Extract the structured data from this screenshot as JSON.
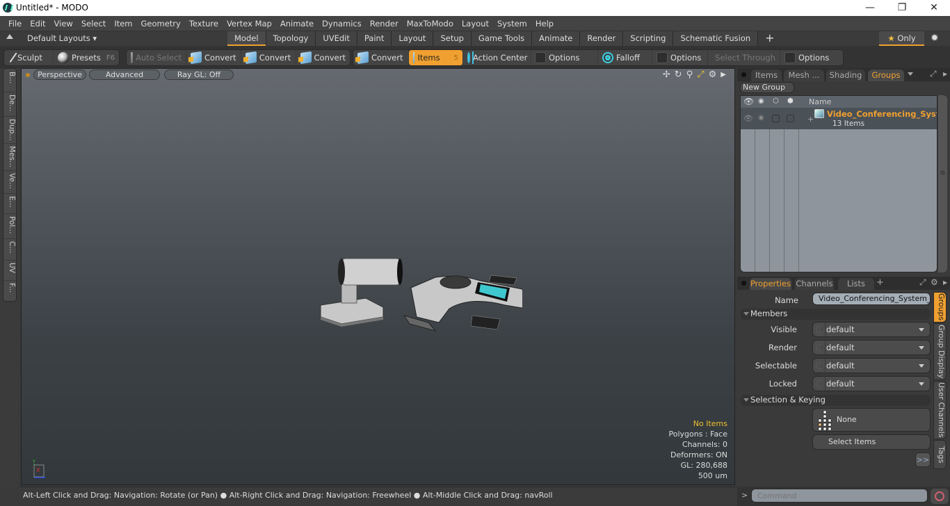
{
  "window": {
    "title": "Untitled* - MODO",
    "minimize": "—",
    "maximize": "❐",
    "close": "✕"
  },
  "menu": [
    "File",
    "Edit",
    "View",
    "Select",
    "Item",
    "Geometry",
    "Texture",
    "Vertex Map",
    "Animate",
    "Dynamics",
    "Render",
    "MaxToModo",
    "Layout",
    "System",
    "Help"
  ],
  "layoutbar": {
    "layouts_label": "Default Layouts ▾",
    "tabs": [
      "Model",
      "Topology",
      "UVEdit",
      "Paint",
      "Layout",
      "Setup",
      "Game Tools",
      "Animate",
      "Render",
      "Scripting",
      "Schematic Fusion"
    ],
    "active_tab": "Model",
    "add_tab": "+",
    "only_label": "Only",
    "star": "★",
    "gear": "✹"
  },
  "toolbar": {
    "sculpt": "Sculpt",
    "presets": "Presets",
    "presets_key": "F6",
    "auto_select": "Auto Select",
    "convert1": "Convert",
    "convert2": "Convert",
    "convert3": "Convert",
    "convert4": "Convert",
    "items": "Items",
    "items_count": "5",
    "action_center": "Action Center",
    "options1": "Options",
    "falloff": "Falloff",
    "options2": "Options",
    "select_through": "Select Through",
    "options3": "Options"
  },
  "left_tabs": [
    "B...",
    "De...",
    "Dup...",
    "Mes...",
    "Ve...",
    "E...",
    "Pol...",
    "C...",
    "UV",
    "F..."
  ],
  "viewport": {
    "view_mode": "Perspective",
    "shading": "Advanced",
    "raygl": "Ray GL: Off",
    "stats": {
      "selection": "No Items",
      "polygons": "Polygons : Face",
      "channels": "Channels: 0",
      "deformers": "Deformers: ON",
      "gl": "GL: 280,688",
      "unit": "500 um"
    },
    "axis": {
      "y": "Y",
      "x": "X"
    }
  },
  "statusbar": "Alt-Left Click and Drag: Navigation: Rotate (or Pan) ● Alt-Right Click and Drag: Navigation: Freewheel ● Alt-Middle Click and Drag: navRoll",
  "groups_panel": {
    "tabs": [
      "Items",
      "Mesh ...",
      "Shading",
      "Groups"
    ],
    "active_tab": "Groups",
    "new_group": "New Group",
    "col_name": "Name",
    "group": {
      "name": "Video_Conferencing_Syst...",
      "count": "13 Items",
      "expand": "+"
    }
  },
  "properties_panel": {
    "tabs": [
      "Properties",
      "Channels",
      "Lists"
    ],
    "active_tab": "Properties",
    "add_tab": "+",
    "name_label": "Name",
    "name_value": "Video_Conferencing_System_Set",
    "members_section": "Members",
    "fields": [
      {
        "label": "Visible",
        "value": "default"
      },
      {
        "label": "Render",
        "value": "default"
      },
      {
        "label": "Selectable",
        "value": "default"
      },
      {
        "label": "Locked",
        "value": "default"
      }
    ],
    "selection_section": "Selection & Keying",
    "none_label": "None",
    "select_items": "Select Items",
    "more": ">>"
  },
  "side_tabs": [
    "Groups",
    "Group Display",
    "User Channels",
    "Tags"
  ],
  "command": {
    "prompt": ">",
    "placeholder": "Command"
  },
  "colors": {
    "accent": "#f0a030",
    "highlight_text": "#f0c030",
    "group_name": "#f0a030"
  }
}
